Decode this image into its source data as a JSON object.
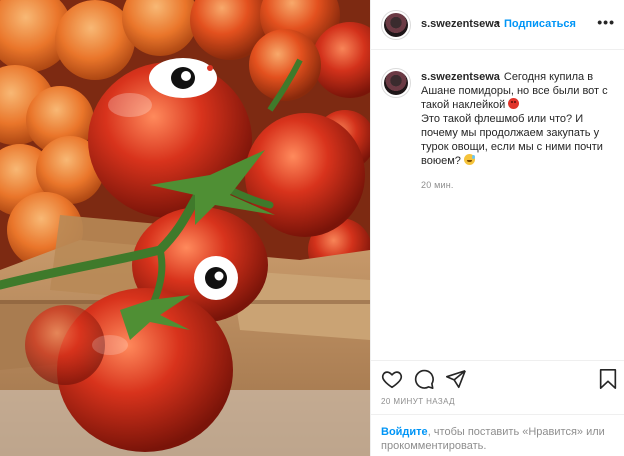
{
  "post": {
    "username": "s.swezentsewa",
    "separator": "•",
    "follow_label": "Подписаться",
    "more_label": "•••",
    "caption": {
      "username": "s.swezentsewa",
      "line1": "Сегодня купила в Ашане помидоры, но все были вот с такой наклейкой",
      "line2": "Это такой флешмоб или что? И почему мы продолжаем закупать у турок овощи, если мы с ними почти воюем?",
      "time": "20 мин."
    },
    "post_time": "20 МИНУТ НАЗАД"
  },
  "footer": {
    "login_link": "Войдите",
    "login_text": ", чтобы поставить «Нравится» или прокомментировать."
  },
  "icons": {
    "like": "heart-icon",
    "comment": "comment-icon",
    "share": "paper-plane-icon",
    "save": "bookmark-icon",
    "emoji1": "angry-face-emoji",
    "emoji2": "sweat-smile-emoji"
  },
  "colors": {
    "accent": "#0095f6",
    "text": "#262626",
    "muted": "#8e8e8e",
    "border": "#efefef"
  }
}
